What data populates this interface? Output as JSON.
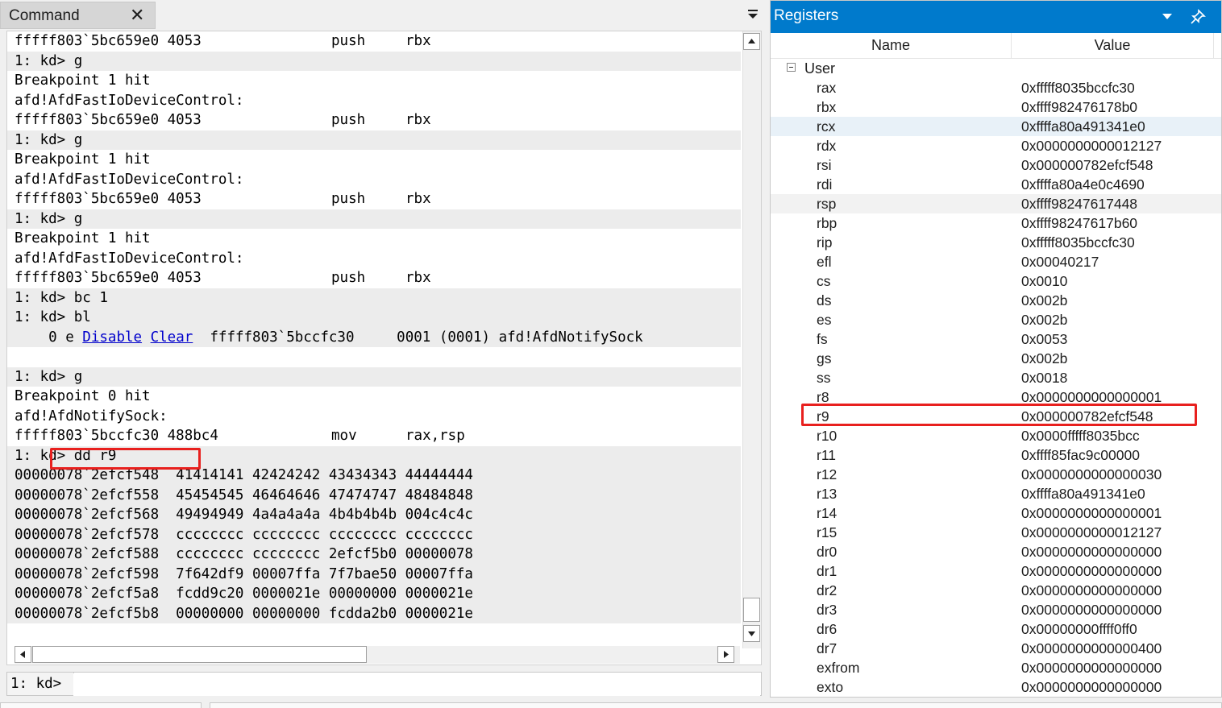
{
  "command_pane": {
    "tab_label": "Command",
    "close_glyph": "✕",
    "lines": [
      {
        "cols": [
          "fffff803`5bc659e0 4053",
          "push",
          "rbx"
        ],
        "shade": false
      },
      {
        "text": "1: kd> g",
        "shade": true
      },
      {
        "text": "Breakpoint 1 hit",
        "shade": false
      },
      {
        "text": "afd!AfdFastIoDeviceControl:",
        "shade": false
      },
      {
        "cols": [
          "fffff803`5bc659e0 4053",
          "push",
          "rbx"
        ],
        "shade": false
      },
      {
        "text": "1: kd> g",
        "shade": true
      },
      {
        "text": "Breakpoint 1 hit",
        "shade": false
      },
      {
        "text": "afd!AfdFastIoDeviceControl:",
        "shade": false
      },
      {
        "cols": [
          "fffff803`5bc659e0 4053",
          "push",
          "rbx"
        ],
        "shade": false
      },
      {
        "text": "1: kd> g",
        "shade": true
      },
      {
        "text": "Breakpoint 1 hit",
        "shade": false
      },
      {
        "text": "afd!AfdFastIoDeviceControl:",
        "shade": false
      },
      {
        "cols": [
          "fffff803`5bc659e0 4053",
          "push",
          "rbx"
        ],
        "shade": false
      },
      {
        "text": "1: kd> bc 1",
        "shade": true
      },
      {
        "text": "1: kd> bl",
        "shade": true
      },
      {
        "bl": {
          "pre": "    0 e ",
          "disable": "Disable",
          "clear": "Clear",
          "post": "fffff803`5bccfc30     0001 (0001) afd!AfdNotifySock"
        },
        "shade": true
      },
      {
        "text": "",
        "shade": false,
        "blank": true
      },
      {
        "text": "1: kd> g",
        "shade": true
      },
      {
        "text": "Breakpoint 0 hit",
        "shade": false
      },
      {
        "text": "afd!AfdNotifySock:",
        "shade": false
      },
      {
        "cols": [
          "fffff803`5bccfc30 488bc4",
          "mov",
          "rax,rsp"
        ],
        "shade": false
      },
      {
        "text": "1: kd> dd r9",
        "shade": true
      },
      {
        "text": "00000078`2efcf548  41414141 42424242 43434343 44444444",
        "shade": true
      },
      {
        "text": "00000078`2efcf558  45454545 46464646 47474747 48484848",
        "shade": true
      },
      {
        "text": "00000078`2efcf568  49494949 4a4a4a4a 4b4b4b4b 004c4c4c",
        "shade": true
      },
      {
        "text": "00000078`2efcf578  cccccccc cccccccc cccccccc cccccccc",
        "shade": true
      },
      {
        "text": "00000078`2efcf588  cccccccc cccccccc 2efcf5b0 00000078",
        "shade": true
      },
      {
        "text": "00000078`2efcf598  7f642df9 00007ffa 7f7bae50 00007ffa",
        "shade": true
      },
      {
        "text": "00000078`2efcf5a8  fcdd9c20 0000021e 00000000 0000021e",
        "shade": true
      },
      {
        "text": "00000078`2efcf5b8  00000000 00000000 fcdda2b0 0000021e",
        "shade": true
      }
    ],
    "prompt_label": "1: kd>",
    "input_value": ""
  },
  "registers_pane": {
    "title": "Registers",
    "columns": {
      "name": "Name",
      "value": "Value"
    },
    "group": "User",
    "rows": [
      {
        "name": "rax",
        "value": "0xfffff8035bccfc30"
      },
      {
        "name": "rbx",
        "value": "0xffff982476178b0"
      },
      {
        "name": "rcx",
        "value": "0xffffa80a491341e0",
        "selected": true
      },
      {
        "name": "rdx",
        "value": "0x0000000000012127"
      },
      {
        "name": "rsi",
        "value": "0x000000782efcf548"
      },
      {
        "name": "rdi",
        "value": "0xffffa80a4e0c4690"
      },
      {
        "name": "rsp",
        "value": "0xffff98247617448",
        "alt": true
      },
      {
        "name": "rbp",
        "value": "0xffff98247617b60"
      },
      {
        "name": "rip",
        "value": "0xfffff8035bccfc30"
      },
      {
        "name": "efl",
        "value": "0x00040217"
      },
      {
        "name": "cs",
        "value": "0x0010"
      },
      {
        "name": "ds",
        "value": "0x002b"
      },
      {
        "name": "es",
        "value": "0x002b"
      },
      {
        "name": "fs",
        "value": "0x0053"
      },
      {
        "name": "gs",
        "value": "0x002b"
      },
      {
        "name": "ss",
        "value": "0x0018"
      },
      {
        "name": "r8",
        "value": "0x0000000000000001"
      },
      {
        "name": "r9",
        "value": "0x000000782efcf548"
      },
      {
        "name": "r10",
        "value": "0x0000fffff8035bcc"
      },
      {
        "name": "r11",
        "value": "0xffff85fac9c00000"
      },
      {
        "name": "r12",
        "value": "0x0000000000000030"
      },
      {
        "name": "r13",
        "value": "0xffffa80a491341e0"
      },
      {
        "name": "r14",
        "value": "0x0000000000000001"
      },
      {
        "name": "r15",
        "value": "0x0000000000012127"
      },
      {
        "name": "dr0",
        "value": "0x0000000000000000"
      },
      {
        "name": "dr1",
        "value": "0x0000000000000000"
      },
      {
        "name": "dr2",
        "value": "0x0000000000000000"
      },
      {
        "name": "dr3",
        "value": "0x0000000000000000"
      },
      {
        "name": "dr6",
        "value": "0x00000000ffff0ff0"
      },
      {
        "name": "dr7",
        "value": "0x0000000000000400"
      },
      {
        "name": "exfrom",
        "value": "0x0000000000000000"
      },
      {
        "name": "exto",
        "value": "0x0000000000000000"
      }
    ]
  },
  "colors": {
    "title_bar": "#007acc",
    "highlight_box": "#e8201e",
    "link": "#0000cc"
  }
}
